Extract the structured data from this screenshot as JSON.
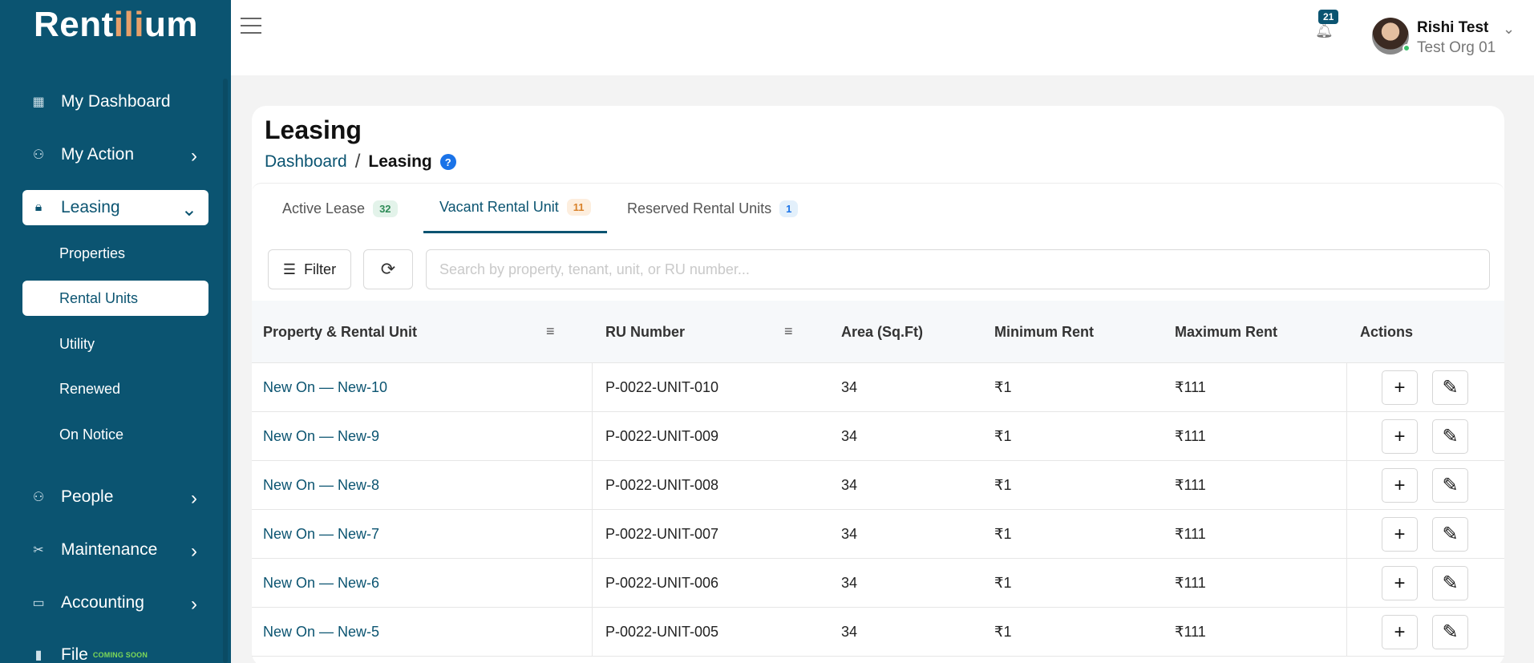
{
  "app": {
    "logo_prefix": "Rent",
    "logo_accent": "ili",
    "logo_suffix": "um"
  },
  "sidebar": {
    "items": [
      {
        "label": "My Dashboard",
        "icon": "grid-icon"
      },
      {
        "label": "My Action",
        "icon": "person-icon"
      },
      {
        "label": "Leasing",
        "icon": "lock-icon"
      },
      {
        "label": "People",
        "icon": "people-icon"
      },
      {
        "label": "Maintenance",
        "icon": "tools-icon"
      },
      {
        "label": "Accounting",
        "icon": "wallet-icon"
      },
      {
        "label": "File",
        "icon": "file-icon",
        "tag": "COMING SOON"
      }
    ],
    "subitems": [
      "Properties",
      "Rental Units",
      "Utility",
      "Renewed",
      "On Notice"
    ]
  },
  "topbar": {
    "notification_count": "21",
    "user_name": "Rishi Test",
    "user_org": "Test Org 01"
  },
  "page": {
    "title": "Leasing",
    "breadcrumb_link": "Dashboard",
    "breadcrumb_sep": "/",
    "breadcrumb_current": "Leasing",
    "help": "?"
  },
  "tabs": [
    {
      "label": "Active Lease",
      "count": "32",
      "badge_bg": "#e3f3ea",
      "badge_fg": "#2e8b57"
    },
    {
      "label": "Vacant Rental Unit",
      "count": "11",
      "badge_bg": "#fdeede",
      "badge_fg": "#d9822b"
    },
    {
      "label": "Reserved Rental Units",
      "count": "1",
      "badge_bg": "#e3f0fb",
      "badge_fg": "#1a73e8"
    }
  ],
  "toolbar": {
    "filter_label": "Filter",
    "search_placeholder": "Search by property, tenant, unit, or RU number..."
  },
  "table": {
    "columns": [
      "Property & Rental Unit",
      "RU Number",
      "Area (Sq.Ft)",
      "Minimum Rent",
      "Maximum Rent",
      "Actions"
    ],
    "rows": [
      {
        "unit": "New On — New-10",
        "ru": "P-0022-UNIT-010",
        "area": "34",
        "min": "₹1",
        "max": "₹111"
      },
      {
        "unit": "New On — New-9",
        "ru": "P-0022-UNIT-009",
        "area": "34",
        "min": "₹1",
        "max": "₹111"
      },
      {
        "unit": "New On — New-8",
        "ru": "P-0022-UNIT-008",
        "area": "34",
        "min": "₹1",
        "max": "₹111"
      },
      {
        "unit": "New On — New-7",
        "ru": "P-0022-UNIT-007",
        "area": "34",
        "min": "₹1",
        "max": "₹111"
      },
      {
        "unit": "New On — New-6",
        "ru": "P-0022-UNIT-006",
        "area": "34",
        "min": "₹1",
        "max": "₹111"
      },
      {
        "unit": "New On — New-5",
        "ru": "P-0022-UNIT-005",
        "area": "34",
        "min": "₹1",
        "max": "₹111"
      }
    ],
    "add_icon": "+",
    "edit_icon": "✎"
  },
  "colors": {
    "sidebar_bg": "#0b5471",
    "accent": "#0b5471"
  }
}
